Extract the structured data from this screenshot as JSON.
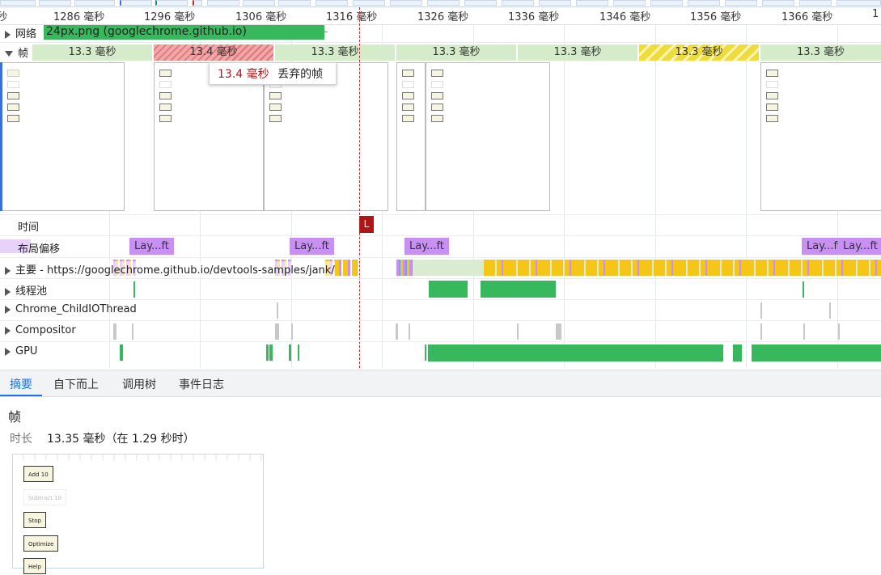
{
  "ruler": {
    "ticks": [
      "秒",
      "1286 毫秒",
      "1296 毫秒",
      "1306 毫秒",
      "1316 毫秒",
      "1326 毫秒",
      "1336 毫秒",
      "1346 毫秒",
      "1356 毫秒",
      "1366 毫秒",
      "1"
    ]
  },
  "network": {
    "label": "网络",
    "request": "24px.png (googlechrome.github.io)"
  },
  "frames": {
    "label": "帧",
    "segments": [
      "13.3 毫秒",
      "13.4 毫秒",
      "13.3 毫秒",
      "13.3 毫秒",
      "13.3 毫秒",
      "13.3 毫秒",
      "13.3 毫秒"
    ],
    "tooltip_duration": "13.4 毫秒",
    "tooltip_text": "丢弃的帧"
  },
  "timings": {
    "label": "时间",
    "marker": "L"
  },
  "layout_shifts": {
    "label": "布局偏移",
    "chips": [
      "Lay...ft",
      "Lay...ft",
      "Lay...ft",
      "Lay...ft",
      "Lay...ft"
    ]
  },
  "tracks": {
    "main": "主要 - https://googlechrome.github.io/devtools-samples/jank/",
    "thread_pool": "线程池",
    "io_thread": "Chrome_ChildIOThread",
    "compositor": "Compositor",
    "gpu": "GPU"
  },
  "tabs": [
    "摘要",
    "自下而上",
    "调用树",
    "事件日志"
  ],
  "summary": {
    "title": "帧",
    "duration_label": "时长",
    "duration_value": "13.35 毫秒（在 1.29 秒时）"
  },
  "preview_buttons": [
    "Add 10",
    "Subtract 10",
    "Stop",
    "Optimize",
    "Help"
  ],
  "colors": {
    "frame_ok": "#d5eccb",
    "frame_dropped": "#e07878",
    "frame_partial": "#eedc3c",
    "layout_shift": "#c890f3",
    "gpu": "#37b85c",
    "main_scripting": "#f5c518",
    "accent": "#1a73e8",
    "marker": "#b01515"
  }
}
